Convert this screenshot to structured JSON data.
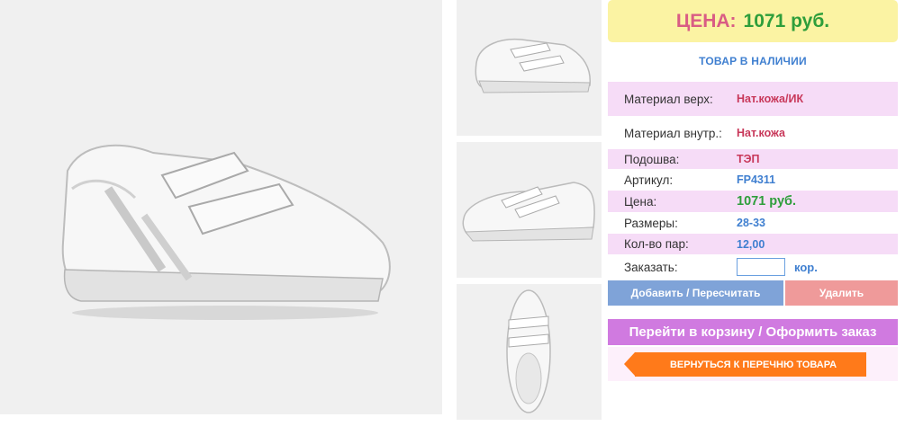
{
  "product_images": {
    "main_alt": "",
    "thumbnails": [
      "",
      "",
      ""
    ]
  },
  "price_box": {
    "label": "ЦЕНА:",
    "value": "1071 руб."
  },
  "stock_status": "ТОВАР В НАЛИЧИИ",
  "specs": [
    {
      "label": "Материал верх:",
      "value": "Нат.кожа/ИК"
    },
    {
      "label": "Материал внутр.:",
      "value": "Нат.кожа"
    },
    {
      "label": "Подошва:",
      "value": "ТЭП"
    },
    {
      "label": "Артикул:",
      "value": "FP4311"
    },
    {
      "label": "Цена:",
      "value": "1071 руб."
    },
    {
      "label": "Размеры:",
      "value": "28-33"
    },
    {
      "label": "Кол-во пар:",
      "value": "12,00"
    }
  ],
  "order": {
    "label": "Заказать:",
    "quantity_value": "",
    "unit": "кор."
  },
  "buttons": {
    "add": "Добавить / Пересчитать",
    "delete": "Удалить",
    "cart": "Перейти в корзину / Оформить заказ",
    "back": "ВЕРНУТЬСЯ К ПЕРЕЧНЮ ТОВАРА"
  },
  "colors": {
    "price_bg": "#fbf3a3",
    "price_label": "#d95c84",
    "price_value": "#2e9e3b",
    "row_pink": "#f6dcf7",
    "add_button": "#7fa3d8",
    "delete_button": "#ef9a9a",
    "cart_button": "#d07ae0",
    "back_button": "#ff7a1a"
  }
}
